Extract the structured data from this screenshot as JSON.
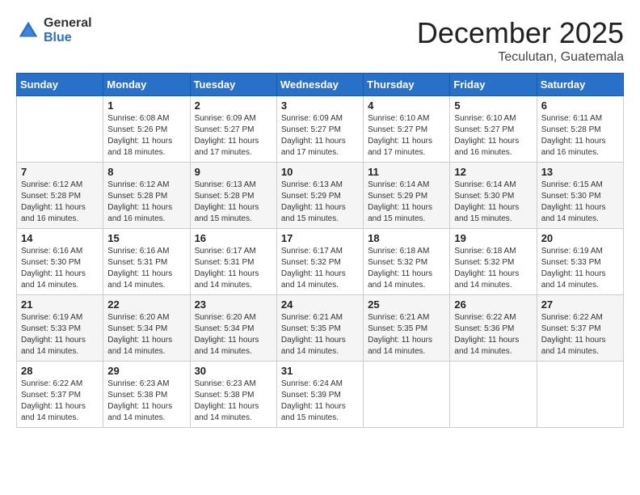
{
  "logo": {
    "general": "General",
    "blue": "Blue"
  },
  "title": {
    "month": "December 2025",
    "location": "Teculutan, Guatemala"
  },
  "weekdays": [
    "Sunday",
    "Monday",
    "Tuesday",
    "Wednesday",
    "Thursday",
    "Friday",
    "Saturday"
  ],
  "weeks": [
    [
      {
        "day": "",
        "sunrise": "",
        "sunset": "",
        "daylight": ""
      },
      {
        "day": "1",
        "sunrise": "Sunrise: 6:08 AM",
        "sunset": "Sunset: 5:26 PM",
        "daylight": "Daylight: 11 hours and 18 minutes."
      },
      {
        "day": "2",
        "sunrise": "Sunrise: 6:09 AM",
        "sunset": "Sunset: 5:27 PM",
        "daylight": "Daylight: 11 hours and 17 minutes."
      },
      {
        "day": "3",
        "sunrise": "Sunrise: 6:09 AM",
        "sunset": "Sunset: 5:27 PM",
        "daylight": "Daylight: 11 hours and 17 minutes."
      },
      {
        "day": "4",
        "sunrise": "Sunrise: 6:10 AM",
        "sunset": "Sunset: 5:27 PM",
        "daylight": "Daylight: 11 hours and 17 minutes."
      },
      {
        "day": "5",
        "sunrise": "Sunrise: 6:10 AM",
        "sunset": "Sunset: 5:27 PM",
        "daylight": "Daylight: 11 hours and 16 minutes."
      },
      {
        "day": "6",
        "sunrise": "Sunrise: 6:11 AM",
        "sunset": "Sunset: 5:28 PM",
        "daylight": "Daylight: 11 hours and 16 minutes."
      }
    ],
    [
      {
        "day": "7",
        "sunrise": "Sunrise: 6:12 AM",
        "sunset": "Sunset: 5:28 PM",
        "daylight": "Daylight: 11 hours and 16 minutes."
      },
      {
        "day": "8",
        "sunrise": "Sunrise: 6:12 AM",
        "sunset": "Sunset: 5:28 PM",
        "daylight": "Daylight: 11 hours and 16 minutes."
      },
      {
        "day": "9",
        "sunrise": "Sunrise: 6:13 AM",
        "sunset": "Sunset: 5:28 PM",
        "daylight": "Daylight: 11 hours and 15 minutes."
      },
      {
        "day": "10",
        "sunrise": "Sunrise: 6:13 AM",
        "sunset": "Sunset: 5:29 PM",
        "daylight": "Daylight: 11 hours and 15 minutes."
      },
      {
        "day": "11",
        "sunrise": "Sunrise: 6:14 AM",
        "sunset": "Sunset: 5:29 PM",
        "daylight": "Daylight: 11 hours and 15 minutes."
      },
      {
        "day": "12",
        "sunrise": "Sunrise: 6:14 AM",
        "sunset": "Sunset: 5:30 PM",
        "daylight": "Daylight: 11 hours and 15 minutes."
      },
      {
        "day": "13",
        "sunrise": "Sunrise: 6:15 AM",
        "sunset": "Sunset: 5:30 PM",
        "daylight": "Daylight: 11 hours and 14 minutes."
      }
    ],
    [
      {
        "day": "14",
        "sunrise": "Sunrise: 6:16 AM",
        "sunset": "Sunset: 5:30 PM",
        "daylight": "Daylight: 11 hours and 14 minutes."
      },
      {
        "day": "15",
        "sunrise": "Sunrise: 6:16 AM",
        "sunset": "Sunset: 5:31 PM",
        "daylight": "Daylight: 11 hours and 14 minutes."
      },
      {
        "day": "16",
        "sunrise": "Sunrise: 6:17 AM",
        "sunset": "Sunset: 5:31 PM",
        "daylight": "Daylight: 11 hours and 14 minutes."
      },
      {
        "day": "17",
        "sunrise": "Sunrise: 6:17 AM",
        "sunset": "Sunset: 5:32 PM",
        "daylight": "Daylight: 11 hours and 14 minutes."
      },
      {
        "day": "18",
        "sunrise": "Sunrise: 6:18 AM",
        "sunset": "Sunset: 5:32 PM",
        "daylight": "Daylight: 11 hours and 14 minutes."
      },
      {
        "day": "19",
        "sunrise": "Sunrise: 6:18 AM",
        "sunset": "Sunset: 5:32 PM",
        "daylight": "Daylight: 11 hours and 14 minutes."
      },
      {
        "day": "20",
        "sunrise": "Sunrise: 6:19 AM",
        "sunset": "Sunset: 5:33 PM",
        "daylight": "Daylight: 11 hours and 14 minutes."
      }
    ],
    [
      {
        "day": "21",
        "sunrise": "Sunrise: 6:19 AM",
        "sunset": "Sunset: 5:33 PM",
        "daylight": "Daylight: 11 hours and 14 minutes."
      },
      {
        "day": "22",
        "sunrise": "Sunrise: 6:20 AM",
        "sunset": "Sunset: 5:34 PM",
        "daylight": "Daylight: 11 hours and 14 minutes."
      },
      {
        "day": "23",
        "sunrise": "Sunrise: 6:20 AM",
        "sunset": "Sunset: 5:34 PM",
        "daylight": "Daylight: 11 hours and 14 minutes."
      },
      {
        "day": "24",
        "sunrise": "Sunrise: 6:21 AM",
        "sunset": "Sunset: 5:35 PM",
        "daylight": "Daylight: 11 hours and 14 minutes."
      },
      {
        "day": "25",
        "sunrise": "Sunrise: 6:21 AM",
        "sunset": "Sunset: 5:35 PM",
        "daylight": "Daylight: 11 hours and 14 minutes."
      },
      {
        "day": "26",
        "sunrise": "Sunrise: 6:22 AM",
        "sunset": "Sunset: 5:36 PM",
        "daylight": "Daylight: 11 hours and 14 minutes."
      },
      {
        "day": "27",
        "sunrise": "Sunrise: 6:22 AM",
        "sunset": "Sunset: 5:37 PM",
        "daylight": "Daylight: 11 hours and 14 minutes."
      }
    ],
    [
      {
        "day": "28",
        "sunrise": "Sunrise: 6:22 AM",
        "sunset": "Sunset: 5:37 PM",
        "daylight": "Daylight: 11 hours and 14 minutes."
      },
      {
        "day": "29",
        "sunrise": "Sunrise: 6:23 AM",
        "sunset": "Sunset: 5:38 PM",
        "daylight": "Daylight: 11 hours and 14 minutes."
      },
      {
        "day": "30",
        "sunrise": "Sunrise: 6:23 AM",
        "sunset": "Sunset: 5:38 PM",
        "daylight": "Daylight: 11 hours and 14 minutes."
      },
      {
        "day": "31",
        "sunrise": "Sunrise: 6:24 AM",
        "sunset": "Sunset: 5:39 PM",
        "daylight": "Daylight: 11 hours and 15 minutes."
      },
      {
        "day": "",
        "sunrise": "",
        "sunset": "",
        "daylight": ""
      },
      {
        "day": "",
        "sunrise": "",
        "sunset": "",
        "daylight": ""
      },
      {
        "day": "",
        "sunrise": "",
        "sunset": "",
        "daylight": ""
      }
    ]
  ]
}
